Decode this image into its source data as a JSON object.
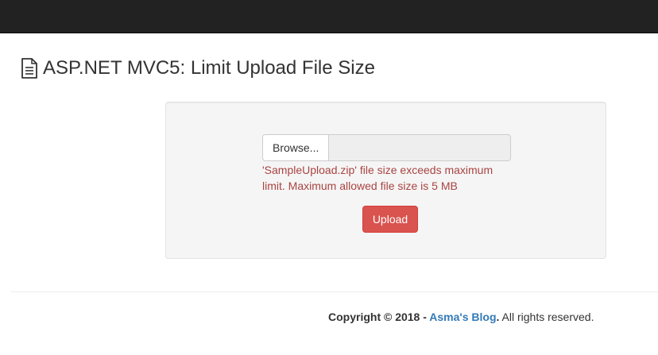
{
  "header": {
    "title": "ASP.NET MVC5: Limit Upload File Size",
    "icon": "document-icon"
  },
  "upload_form": {
    "browse_label": "Browse...",
    "file_name": "",
    "error_message": "'SampleUpload.zip' file size exceeds maximum limit. Maximum allowed file size is 5 MB",
    "upload_label": "Upload",
    "error_color": "#a94442",
    "button_color": "#d9534f"
  },
  "footer": {
    "copyright": "Copyright © 2018 -",
    "blog_link": "Asma's Blog",
    "period": ".",
    "rights": " All rights reserved."
  },
  "colors": {
    "navbar": "#222222",
    "link": "#337ab7"
  }
}
